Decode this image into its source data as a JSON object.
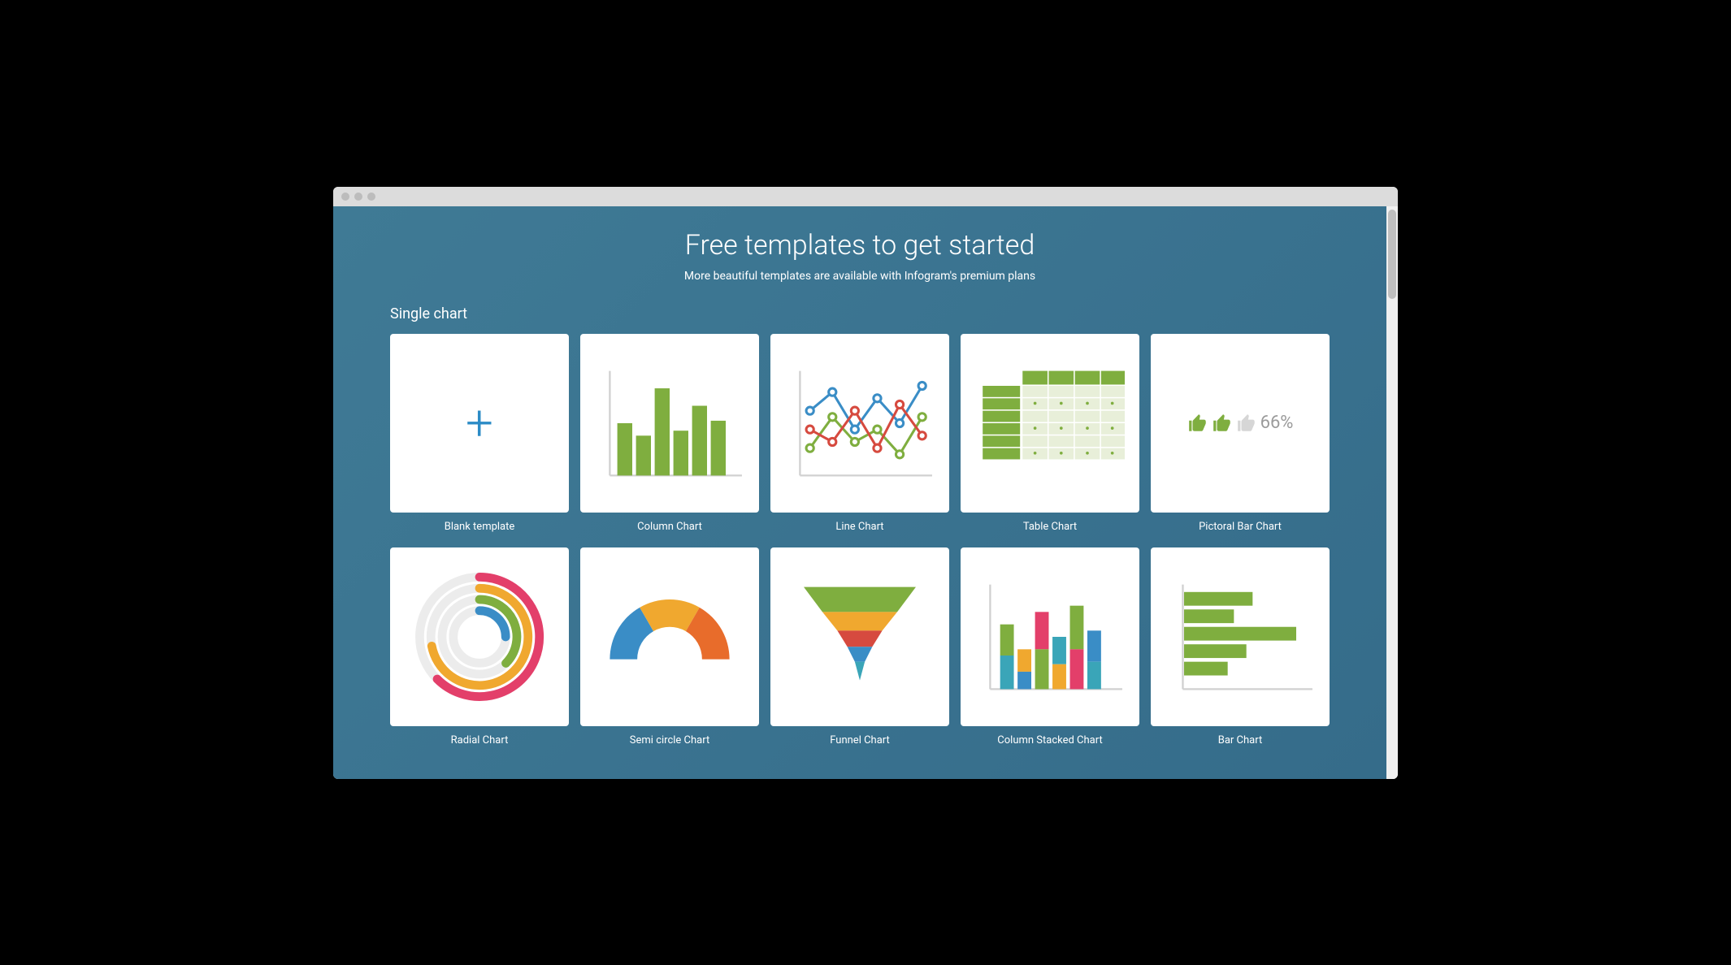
{
  "page": {
    "title": "Free templates to get started",
    "subtitle": "More beautiful templates are available with Infogram's premium plans"
  },
  "section": {
    "title": "Single chart"
  },
  "templates": [
    {
      "label": "Blank template"
    },
    {
      "label": "Column Chart"
    },
    {
      "label": "Line Chart"
    },
    {
      "label": "Table Chart"
    },
    {
      "label": "Pictoral Bar Chart",
      "percent": "66%"
    },
    {
      "label": "Radial Chart"
    },
    {
      "label": "Semi circle Chart"
    },
    {
      "label": "Funnel Chart"
    },
    {
      "label": "Column Stacked Chart"
    },
    {
      "label": "Bar Chart"
    }
  ]
}
